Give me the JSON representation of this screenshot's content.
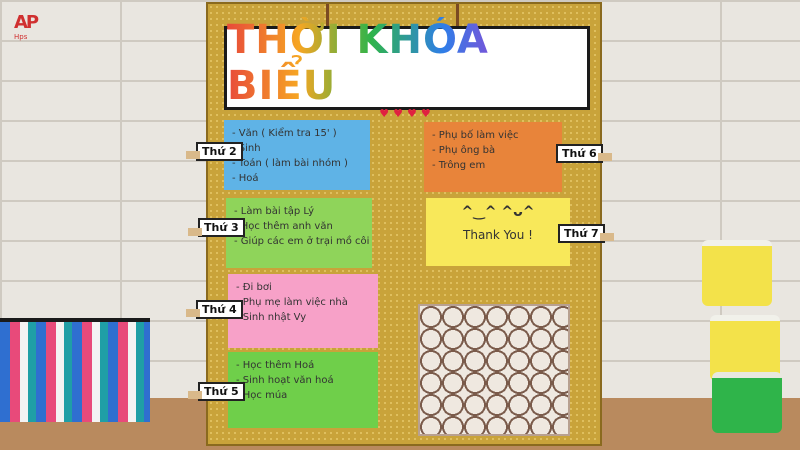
{
  "watermark": {
    "mark": "AP",
    "sub": "Hps"
  },
  "board": {
    "title": "THỜI KHÓA BIỂU",
    "hearts": "♥♥♥♥"
  },
  "days": [
    {
      "tag": "Thứ 2",
      "lines": [
        "- Văn      ( Kiểm tra 15' )",
        "- Sinh",
        "- Toán     ( làm bài nhóm )",
        "- Hoá"
      ],
      "color": "#5fb3e6"
    },
    {
      "tag": "Thứ 3",
      "lines": [
        "- Làm bài tập Lý",
        "- Học thêm anh văn",
        "- Giúp các em ở trại mồ côi"
      ],
      "color": "#8fd45a"
    },
    {
      "tag": "Thứ 4",
      "lines": [
        "- Đi bơi",
        "- Phụ mẹ làm việc nhà",
        "- Sinh nhật Vy"
      ],
      "color": "#f7a1c8"
    },
    {
      "tag": "Thứ 5",
      "lines": [
        "- Học thêm Hoá",
        "- Sinh hoạt văn hoá",
        "- Học múa"
      ],
      "color": "#6fcf4a"
    },
    {
      "tag": "Thứ 6",
      "lines": [
        "- Phụ bố làm việc",
        "- Phụ ông bà",
        "- Trông em"
      ],
      "color": "#e8843a"
    },
    {
      "tag": "Thứ 7",
      "lines": [
        "Thank You !"
      ],
      "face": "^‿^   ^ᴗ^",
      "color": "#f8e85a"
    }
  ]
}
